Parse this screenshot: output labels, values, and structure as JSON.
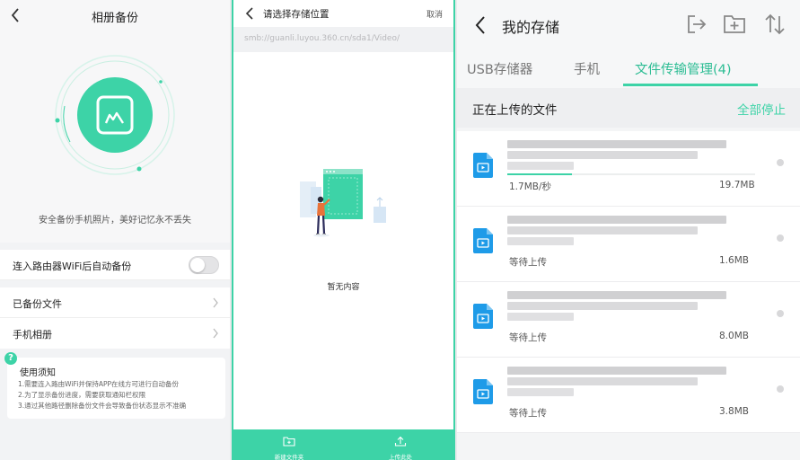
{
  "colors": {
    "accent": "#3dd3a7",
    "accent_text": "#2dbd94"
  },
  "backup_panel": {
    "title": "相册备份",
    "tagline": "安全备份手机照片，美好记忆永不丢失",
    "auto_backup_label": "连入路由器WiFi后自动备份",
    "auto_backup_enabled": false,
    "menu": [
      {
        "label": "已备份文件"
      },
      {
        "label": "手机相册"
      }
    ],
    "notice": {
      "title": "使用须知",
      "lines": [
        "1.需要连入路由WiFi并保持APP在线方可进行自动备份",
        "2.为了显示备份进度，需要获取通知栏权限",
        "3.通过其他路径删除备份文件会导致备份状态显示不准确"
      ]
    }
  },
  "location_panel": {
    "title": "请选择存储位置",
    "cancel": "取消",
    "path": "smb://guanli.luyou.360.cn/sda1/Video/",
    "empty_text": "暂无内容",
    "bottom_buttons": [
      {
        "label": "新建文件夹",
        "icon": "new-folder-icon"
      },
      {
        "label": "上传此处",
        "icon": "upload-icon"
      }
    ]
  },
  "storage_panel": {
    "title": "我的存储",
    "header_icons": [
      "exit-icon",
      "add-folder-icon",
      "sort-icon"
    ],
    "tabs": [
      {
        "label": "USB存储器",
        "active": false
      },
      {
        "label": "手机",
        "active": false
      },
      {
        "label": "文件传输管理(4)",
        "active": true
      }
    ],
    "section_title": "正在上传的文件",
    "stop_all": "全部停止",
    "files": [
      {
        "status": "1.7MB/秒",
        "size": "19.7MB",
        "progress": 0.26
      },
      {
        "status": "等待上传",
        "size": "1.6MB",
        "progress": 0
      },
      {
        "status": "等待上传",
        "size": "8.0MB",
        "progress": 0
      },
      {
        "status": "等待上传",
        "size": "3.8MB",
        "progress": 0
      }
    ]
  }
}
